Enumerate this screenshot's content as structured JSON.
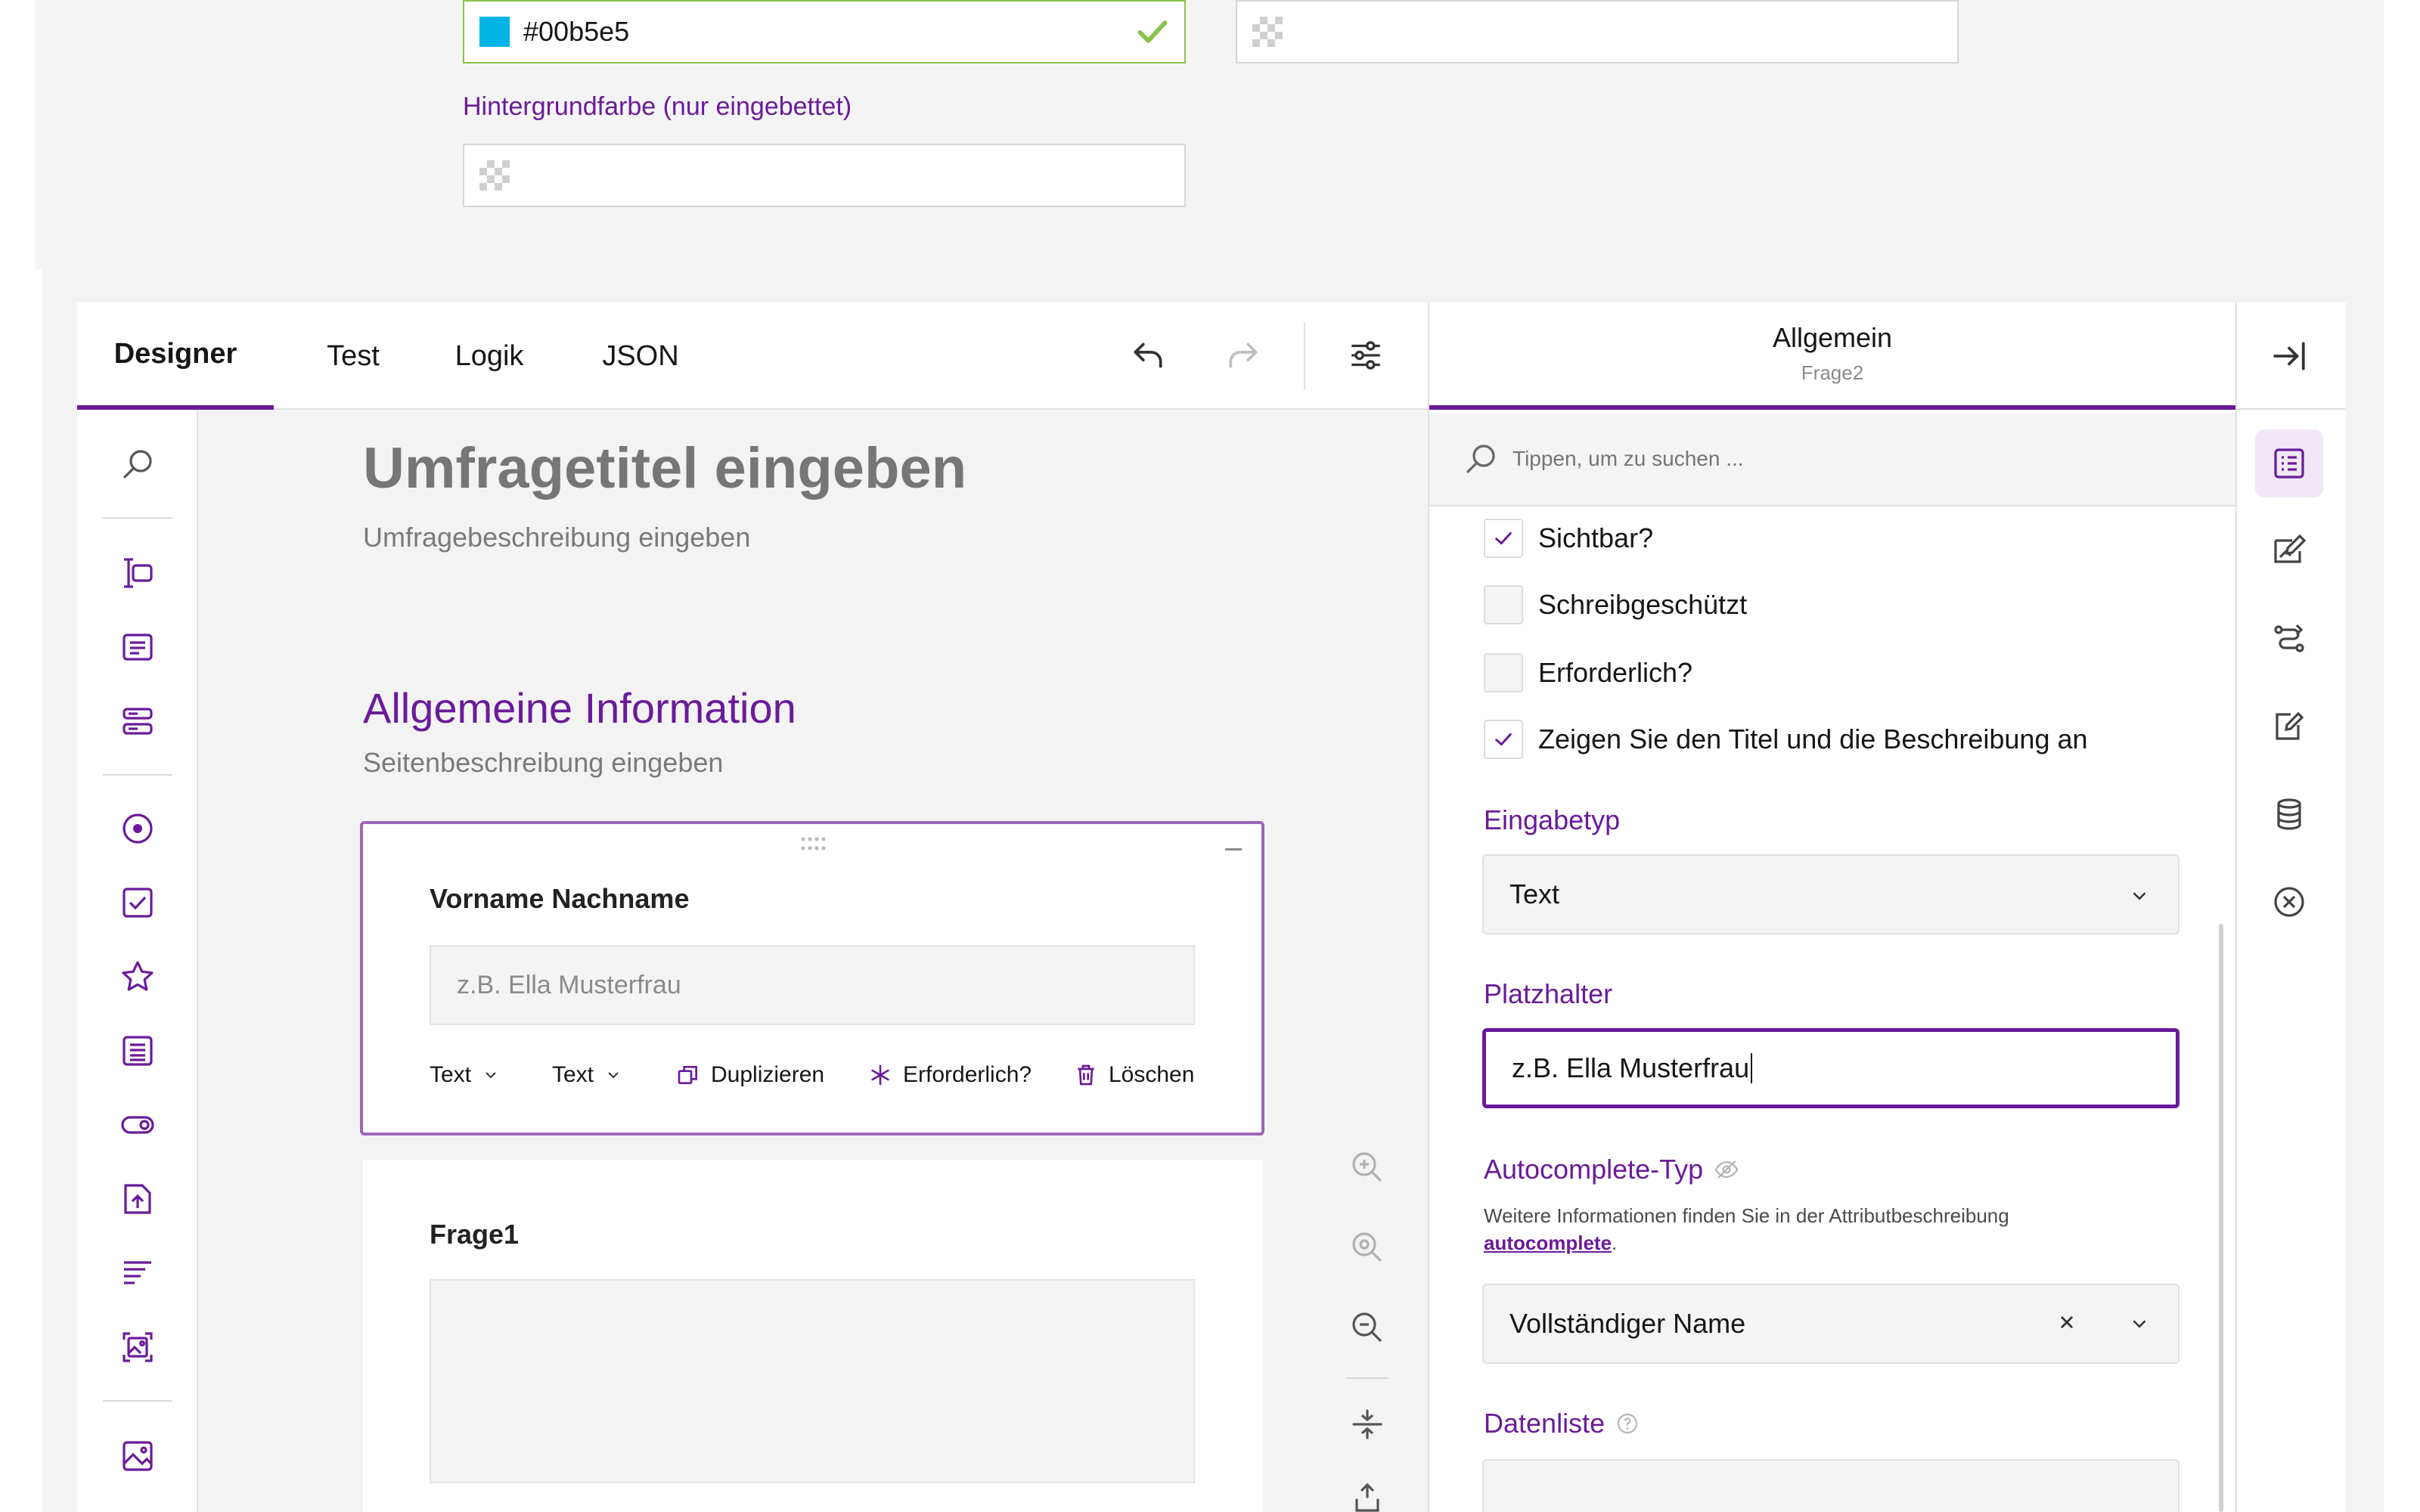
{
  "theme_panel": {
    "primary_color_value": "#00b5e5",
    "primary_swatch_color": "#00b5e5",
    "background_color_label": "Hintergrundfarbe (nur eingebettet)",
    "secondary_color_value": "",
    "background_color_value": ""
  },
  "tabs": {
    "designer": "Designer",
    "test": "Test",
    "logic": "Logik",
    "json": "JSON"
  },
  "toolbar": {
    "undo_icon": "undo-icon",
    "redo_icon": "redo-icon",
    "settings_icon": "sliders-icon"
  },
  "survey": {
    "title": "Umfragetitel eingeben",
    "description": "Umfragebeschreibung eingeben",
    "page_title": "Allgemeine Information",
    "page_description": "Seitenbeschreibung eingeben"
  },
  "question1": {
    "title": "Vorname Nachname",
    "placeholder": "z.B. Ella Musterfrau",
    "type_label": "Text",
    "input_type_label": "Text",
    "duplicate": "Duplizieren",
    "required": "Erforderlich?",
    "delete": "Löschen"
  },
  "question2": {
    "title": "Frage1"
  },
  "property_grid": {
    "header_title": "Allgemein",
    "header_subtitle": "Frage2",
    "search_placeholder": "Tippen, um zu suchen ...",
    "visible": "Sichtbar?",
    "visible_checked": true,
    "readonly": "Schreibgeschützt",
    "readonly_checked": false,
    "required": "Erforderlich?",
    "required_checked": false,
    "show_title": "Zeigen Sie den Titel und die Beschreibung an",
    "show_title_checked": true,
    "input_type_label": "Eingabetyp",
    "input_type_value": "Text",
    "placeholder_label": "Platzhalter",
    "placeholder_value": "z.B. Ella Musterfrau",
    "autocomplete_label": "Autocomplete-Typ",
    "autocomplete_help_prefix": "Weitere Informationen finden Sie in der Attributbeschreibung",
    "autocomplete_link": "autocomplete",
    "autocomplete_help_suffix": ".",
    "autocomplete_value": "Vollständiger Name",
    "datalist_label": "Datenliste"
  },
  "colors": {
    "accent": "#6a1b9a",
    "valid": "#8bc34a",
    "canvas": "#f3f3f3"
  }
}
